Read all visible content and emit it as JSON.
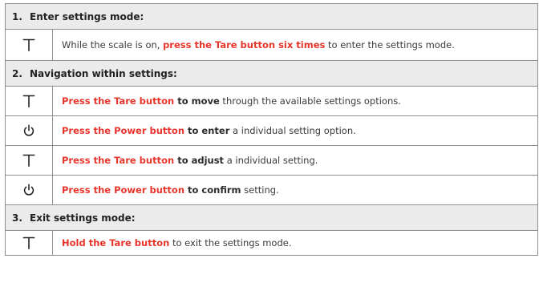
{
  "sections": [
    {
      "number": "1.",
      "title": "Enter settings mode:",
      "steps": [
        {
          "icon": "tare-icon",
          "parts": [
            {
              "text": "While the scale is on, ",
              "style": "normal"
            },
            {
              "text": "press the Tare button six times",
              "style": "red"
            },
            {
              "text": " to enter the settings mode.",
              "style": "normal"
            }
          ]
        }
      ]
    },
    {
      "number": "2.",
      "title": "Navigation within settings:",
      "steps": [
        {
          "icon": "tare-icon",
          "parts": [
            {
              "text": "Press the Tare button",
              "style": "red"
            },
            {
              "text": " to move",
              "style": "bold"
            },
            {
              "text": " through the available settings options.",
              "style": "normal"
            }
          ]
        },
        {
          "icon": "power-icon",
          "parts": [
            {
              "text": "Press the Power button",
              "style": "red"
            },
            {
              "text": " to enter",
              "style": "bold"
            },
            {
              "text": " a individual setting option.",
              "style": "normal"
            }
          ]
        },
        {
          "icon": "tare-icon",
          "parts": [
            {
              "text": "Press the Tare button",
              "style": "red"
            },
            {
              "text": " to adjust",
              "style": "bold"
            },
            {
              "text": " a individual setting.",
              "style": "normal"
            }
          ]
        },
        {
          "icon": "power-icon",
          "parts": [
            {
              "text": "Press the Power button",
              "style": "red"
            },
            {
              "text": " to confirm",
              "style": "bold"
            },
            {
              "text": " setting.",
              "style": "normal"
            }
          ]
        }
      ]
    },
    {
      "number": "3.",
      "title": "Exit settings mode:",
      "steps": [
        {
          "icon": "tare-icon",
          "parts": [
            {
              "text": "Hold the Tare button",
              "style": "red"
            },
            {
              "text": " to exit the settings mode.",
              "style": "normal"
            }
          ]
        }
      ]
    }
  ],
  "colors": {
    "highlight": "#e8352b",
    "header_bg": "#ebebeb",
    "border": "#8e8e8e"
  }
}
